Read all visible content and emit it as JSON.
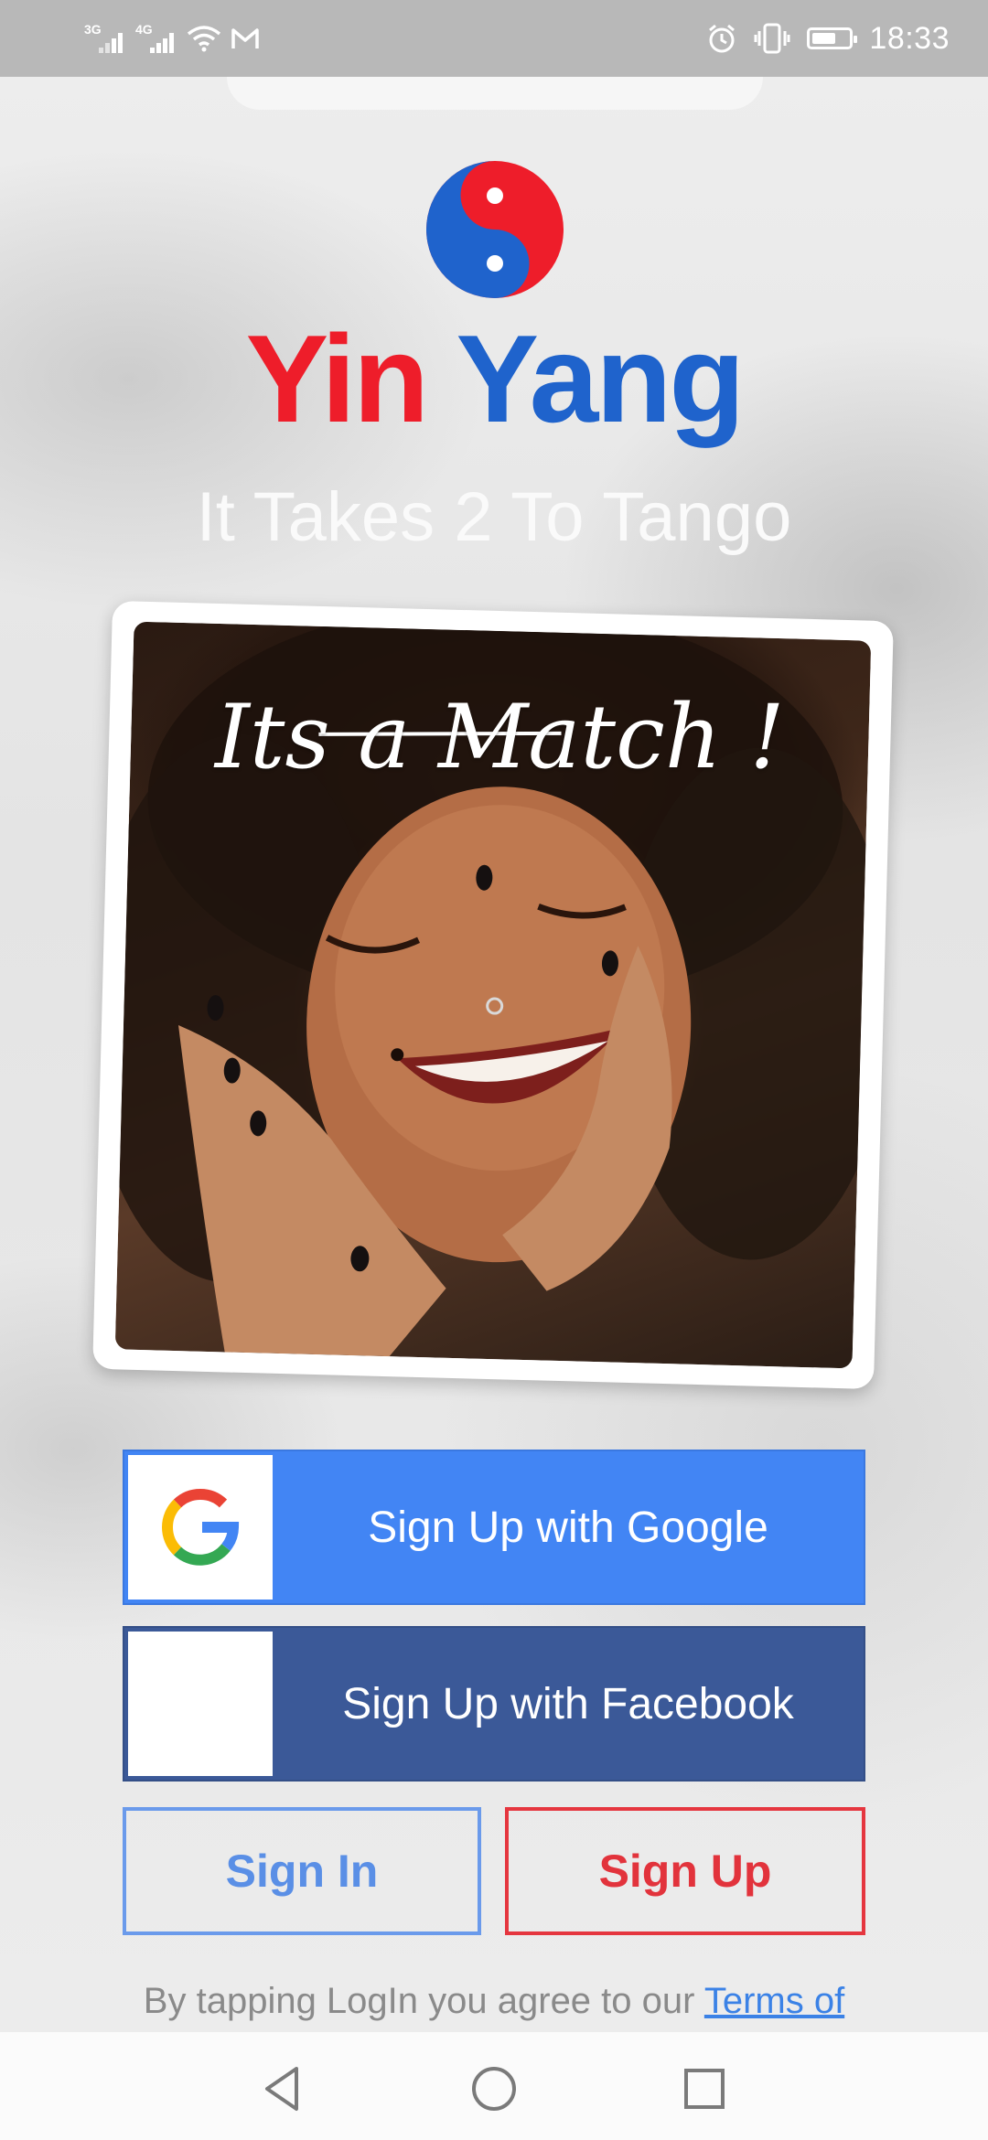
{
  "status_bar": {
    "network_1": "3G",
    "network_2": "4G",
    "time": "18:33",
    "icons": [
      "signal-icon",
      "signal-icon",
      "wifi-icon",
      "gmail-icon",
      "alarm-icon",
      "vibrate-icon",
      "battery-icon"
    ]
  },
  "logo": {
    "word_1": "Yin",
    "word_2": "Yang",
    "color_red": "#ee1d2a",
    "color_blue": "#1f63cc"
  },
  "tagline": "It Takes 2 To Tango",
  "match_card": {
    "title": "Its a Match !"
  },
  "buttons": {
    "google_label": "Sign Up with Google",
    "facebook_label": "Sign Up with Facebook",
    "signin_label": "Sign In",
    "signup_label": "Sign Up"
  },
  "legal": {
    "text": "By tapping LogIn you agree to our ",
    "terms_link": "Terms of"
  },
  "colors": {
    "google_blue": "#4285f4",
    "facebook_blue": "#3b5998",
    "signin_blue": "#5a8fe6",
    "signup_red": "#e2333c"
  }
}
